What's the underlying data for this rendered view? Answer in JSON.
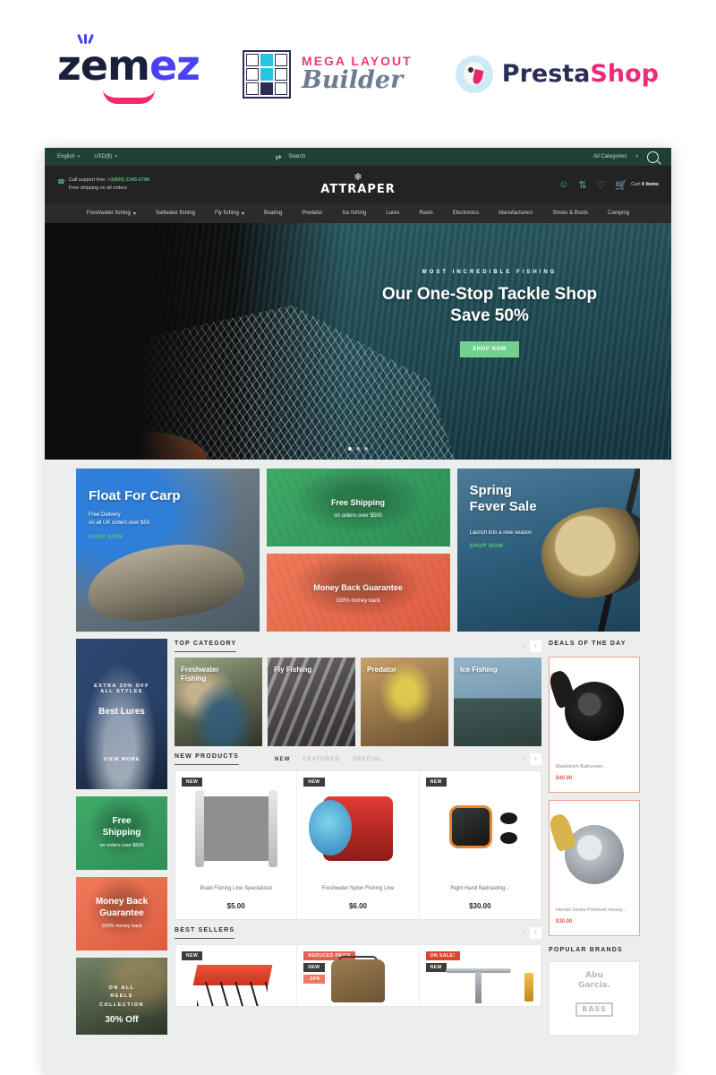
{
  "brandbar": {
    "zemez": {
      "part1": "z",
      "part2": "em",
      "part3": "e",
      "part4": "z",
      "alt": "zemez-logo"
    },
    "mega_layout_builder": {
      "line1": "MEGA LAYOUT",
      "line2": "Builder"
    },
    "prestashop": {
      "part1": "Presta",
      "part2": "Shop"
    }
  },
  "store": {
    "topbar": {
      "language": "English",
      "currency": "USD($)",
      "compare_icon": "compare-icon",
      "search_label": "Search",
      "categories_select": "All Categories",
      "search_icon": "search-icon"
    },
    "header": {
      "support_label": "Call support free:",
      "phone": "+3(800) 2345-6789",
      "shipping_note": "Free shipping on all orders",
      "logo_name": "ATTRAPER",
      "icons": [
        "user-icon",
        "compare-icon",
        "heart-icon",
        "cart-icon"
      ],
      "cart_text": "Cart ",
      "cart_count": "0 items"
    },
    "nav": [
      {
        "label": "Freshwater fishing",
        "has_dropdown": true
      },
      {
        "label": "Saltwater fishing",
        "has_dropdown": false
      },
      {
        "label": "Fly fishing",
        "has_dropdown": true
      },
      {
        "label": "Boating",
        "has_dropdown": false
      },
      {
        "label": "Predator",
        "has_dropdown": false
      },
      {
        "label": "Ice fishing",
        "has_dropdown": false
      },
      {
        "label": "Lures",
        "has_dropdown": false
      },
      {
        "label": "Reels",
        "has_dropdown": false
      },
      {
        "label": "Electronics",
        "has_dropdown": false
      },
      {
        "label": "Manufacturers",
        "has_dropdown": false
      },
      {
        "label": "Shoes & Boots",
        "has_dropdown": false
      },
      {
        "label": "Camping",
        "has_dropdown": false
      }
    ],
    "hero": {
      "kicker": "MOST INCREDIBLE FISHING",
      "title_line1": "Our One-Stop Tackle Shop",
      "title_line2": "Save 50%",
      "button": "SHOP NOW",
      "slide_count": 3,
      "active_slide": 1
    },
    "promos": [
      {
        "title": "Float For Carp",
        "sub_line1": "Free Delivery",
        "sub_line2": "on all UK orders over $50",
        "link": "SHOP NOW"
      },
      {
        "title": "Free Shipping",
        "sub": "on orders over $500"
      },
      {
        "title": "Money Back Guarantee",
        "sub": "100% money back"
      },
      {
        "title_line1": "Spring",
        "title_line2": "Fever Sale",
        "sub": "Launch into a new season",
        "link": "SHOP NOW"
      }
    ],
    "side_banners": [
      {
        "kicker_line1": "EXTRA 30% OFF",
        "kicker_line2": "ALL STYLES",
        "title": "Best Lures",
        "button": "VIEW MORE"
      },
      {
        "title_line1": "Free",
        "title_line2": "Shipping",
        "sub": "on orders over $500"
      },
      {
        "title_line1": "Money Back",
        "title_line2": "Guarantee",
        "sub": "100% money back"
      },
      {
        "kicker_line1": "ON ALL",
        "kicker_line2": "REELS",
        "kicker_line3": "COLLECTION",
        "title": "30% Off"
      }
    ],
    "top_category": {
      "heading": "TOP CATEGORY",
      "prev_icon": "chevron-left-icon",
      "next_icon": "chevron-right-icon",
      "items": [
        {
          "label_line1": "Freshwater",
          "label_line2": "Fishing"
        },
        {
          "label_line1": "Fly Fishing",
          "label_line2": ""
        },
        {
          "label_line1": "Predator",
          "label_line2": ""
        },
        {
          "label_line1": "Ice Fishing",
          "label_line2": ""
        }
      ]
    },
    "new_products": {
      "heading": "NEW PRODUCTS",
      "tabs": [
        {
          "label": "NEW",
          "active": true
        },
        {
          "label": "FEATURED",
          "active": false
        },
        {
          "label": "SPECIAL",
          "active": false
        }
      ],
      "items": [
        {
          "badge": "NEW",
          "name": "Braid Fishing Line Specialized",
          "price": "$5.00"
        },
        {
          "badge": "NEW",
          "name": "Freshwater Nylon Fishing Line",
          "price": "$6.00"
        },
        {
          "badge": "NEW",
          "name": "Right Hand Baitcasting...",
          "price": "$30.00"
        }
      ]
    },
    "deals_of_the_day": {
      "heading": "DEALS OF THE DAY",
      "items": [
        {
          "name": "Maelstrom Baitrunner...",
          "price": "$40.00"
        },
        {
          "name": "Hornet Series Premium Heavy...",
          "price": "$30.00"
        }
      ]
    },
    "best_sellers": {
      "heading": "BEST SELLERS",
      "items": [
        {
          "badges": [
            "NEW"
          ]
        },
        {
          "badges": [
            "REDUCED PRICE",
            "NEW",
            "-20%"
          ]
        },
        {
          "badges": [
            "ON SALE!",
            "NEW"
          ]
        }
      ]
    },
    "popular_brands": {
      "heading": "POPULAR BRANDS",
      "items": [
        {
          "name_line1": "Abu",
          "name_line2": "Garcia."
        },
        {
          "name": "BASS"
        }
      ]
    },
    "colors": {
      "topbar_green": "#1f4034",
      "header_dark": "#232323",
      "accent_green": "#4cb97e",
      "accent_orange": "#e2604b",
      "page_bg": "#eceded"
    }
  }
}
